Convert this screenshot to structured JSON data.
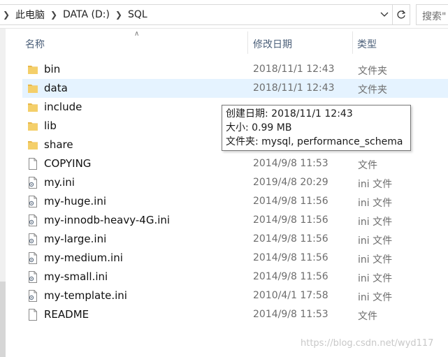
{
  "address": {
    "crumbs": [
      "此电脑",
      "DATA (D:)",
      "SQL"
    ]
  },
  "search": {
    "placeholder": "搜索\""
  },
  "columns": {
    "name": "名称",
    "date": "修改日期",
    "type": "类型"
  },
  "files": [
    {
      "name": "bin",
      "date": "2018/11/1 12:43",
      "type": "文件夹",
      "kind": "folder"
    },
    {
      "name": "data",
      "date": "2018/11/1 12:43",
      "type": "文件夹",
      "kind": "folder"
    },
    {
      "name": "include",
      "date": "",
      "type": "",
      "kind": "folder"
    },
    {
      "name": "lib",
      "date": "",
      "type": "",
      "kind": "folder"
    },
    {
      "name": "share",
      "date": "",
      "type": "",
      "kind": "folder"
    },
    {
      "name": "COPYING",
      "date": "2014/9/8 11:53",
      "type": "文件",
      "kind": "file"
    },
    {
      "name": "my.ini",
      "date": "2019/4/8 20:29",
      "type": "ini 文件",
      "kind": "ini"
    },
    {
      "name": "my-huge.ini",
      "date": "2014/9/8 11:56",
      "type": "ini 文件",
      "kind": "ini"
    },
    {
      "name": "my-innodb-heavy-4G.ini",
      "date": "2014/9/8 11:56",
      "type": "ini 文件",
      "kind": "ini"
    },
    {
      "name": "my-large.ini",
      "date": "2014/9/8 11:56",
      "type": "ini 文件",
      "kind": "ini"
    },
    {
      "name": "my-medium.ini",
      "date": "2014/9/8 11:56",
      "type": "ini 文件",
      "kind": "ini"
    },
    {
      "name": "my-small.ini",
      "date": "2014/9/8 11:56",
      "type": "ini 文件",
      "kind": "ini"
    },
    {
      "name": "my-template.ini",
      "date": "2010/4/1 17:58",
      "type": "ini 文件",
      "kind": "ini"
    },
    {
      "name": "README",
      "date": "2014/9/8 11:53",
      "type": "文件",
      "kind": "file"
    }
  ],
  "tooltip": {
    "created": "创建日期: 2018/11/1 12:43",
    "size": "大小: 0.99 MB",
    "folders": "文件夹: mysql, performance_schema"
  },
  "watermark": "https://blog.csdn.net/wyd117",
  "colors": {
    "hover_row": "#e5f3ff",
    "folder": "#e8b84a",
    "header_text": "#4c607a"
  }
}
